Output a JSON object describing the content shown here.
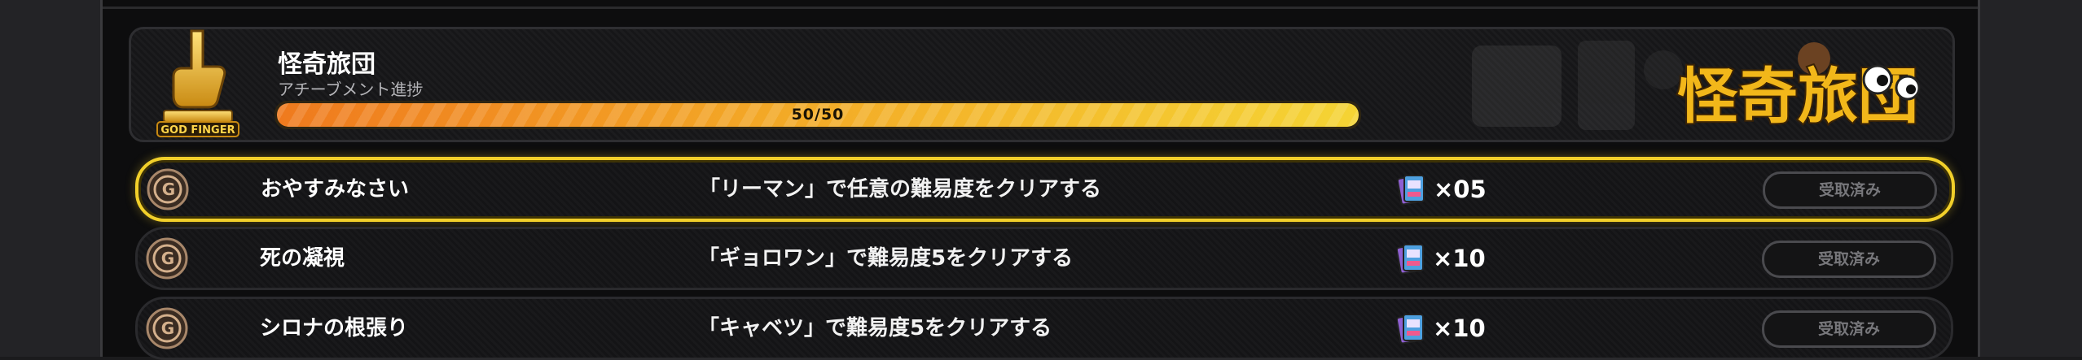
{
  "header": {
    "title": "怪奇旅団",
    "subtitle": "アチーブメント進捗",
    "progress_text": "50/50",
    "progress_fraction": 1.0,
    "badge_text": "GOD FINGER",
    "banner_text": "怪奇旅団"
  },
  "colors": {
    "accent_gold": "#f1cf2a",
    "progress_start": "#ef7a1e",
    "progress_end": "#f5d434"
  },
  "achievements": [
    {
      "name": "おやすみなさい",
      "description": "「リーマン」で任意の難易度をクリアする",
      "reward_icon": "card-pack-icon",
      "quantity": "×05",
      "button": "受取済み",
      "selected": true
    },
    {
      "name": "死の凝視",
      "description": "「ギョロワン」で難易度5をクリアする",
      "reward_icon": "card-pack-icon",
      "quantity": "×10",
      "button": "受取済み",
      "selected": false
    },
    {
      "name": "シロナの根張り",
      "description": "「キャベツ」で難易度5をクリアする",
      "reward_icon": "card-pack-icon",
      "quantity": "×10",
      "button": "受取済み",
      "selected": false
    }
  ]
}
